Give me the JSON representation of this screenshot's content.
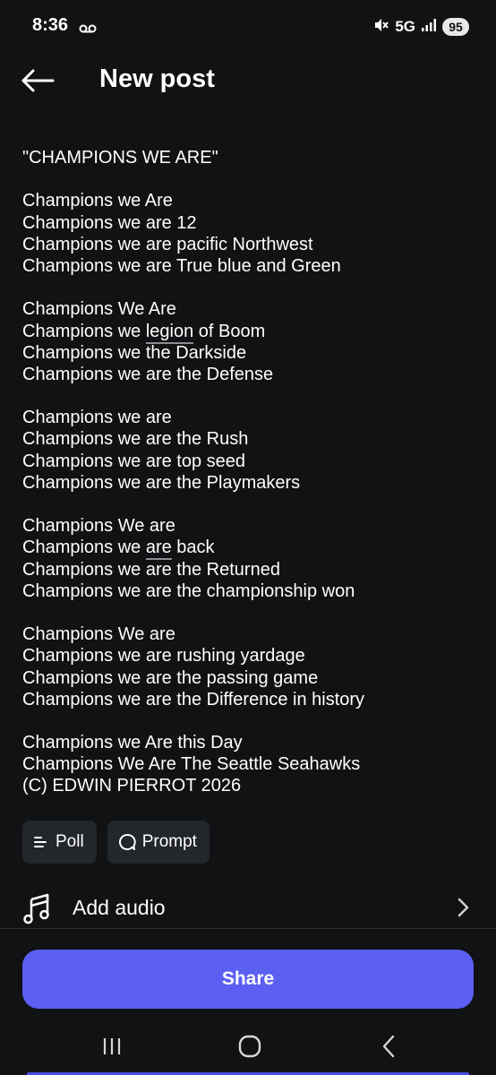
{
  "status_bar": {
    "time": "8:36",
    "network": "5G",
    "battery": "95"
  },
  "header": {
    "title": "New post"
  },
  "post": {
    "lines": [
      "\"CHAMPIONS WE ARE\"",
      "",
      "Champions we Are",
      "Champions we are 12",
      "Champions we are pacific Northwest",
      "Champions we are True blue and Green",
      "",
      "Champions We Are",
      "Champions we legion of Boom",
      "Champions we the Darkside",
      "Champions we are the Defense",
      "",
      "Champions we are",
      "Champions we are the Rush",
      "Champions we are top seed",
      "Champions we are the Playmakers",
      "",
      "Champions We are",
      "Champions we are back",
      "Champions we are the Returned",
      "Champions we are the championship won",
      "",
      "Champions We are",
      "Champions we are rushing yardage",
      "Champions we are the passing game",
      "Champions we are the Difference in history",
      "",
      "Champions we Are this Day",
      "Champions We Are The Seattle Seahawks",
      "(C) EDWIN PIERROT 2026"
    ],
    "underlined_words": {
      "8": "legion",
      "18": "are"
    }
  },
  "chips": {
    "poll_label": "Poll",
    "prompt_label": "Prompt"
  },
  "audio": {
    "label": "Add audio"
  },
  "share": {
    "label": "Share"
  },
  "colors": {
    "background": "#101214",
    "accent": "#5b5ff2",
    "chip_bg": "#23262b"
  },
  "icons": [
    "back-arrow-icon",
    "voicemail-icon",
    "mute-icon",
    "signal-icon",
    "poll-icon",
    "prompt-icon",
    "music-note-icon",
    "chevron-right-icon",
    "recents-icon",
    "home-icon",
    "back-nav-icon"
  ]
}
